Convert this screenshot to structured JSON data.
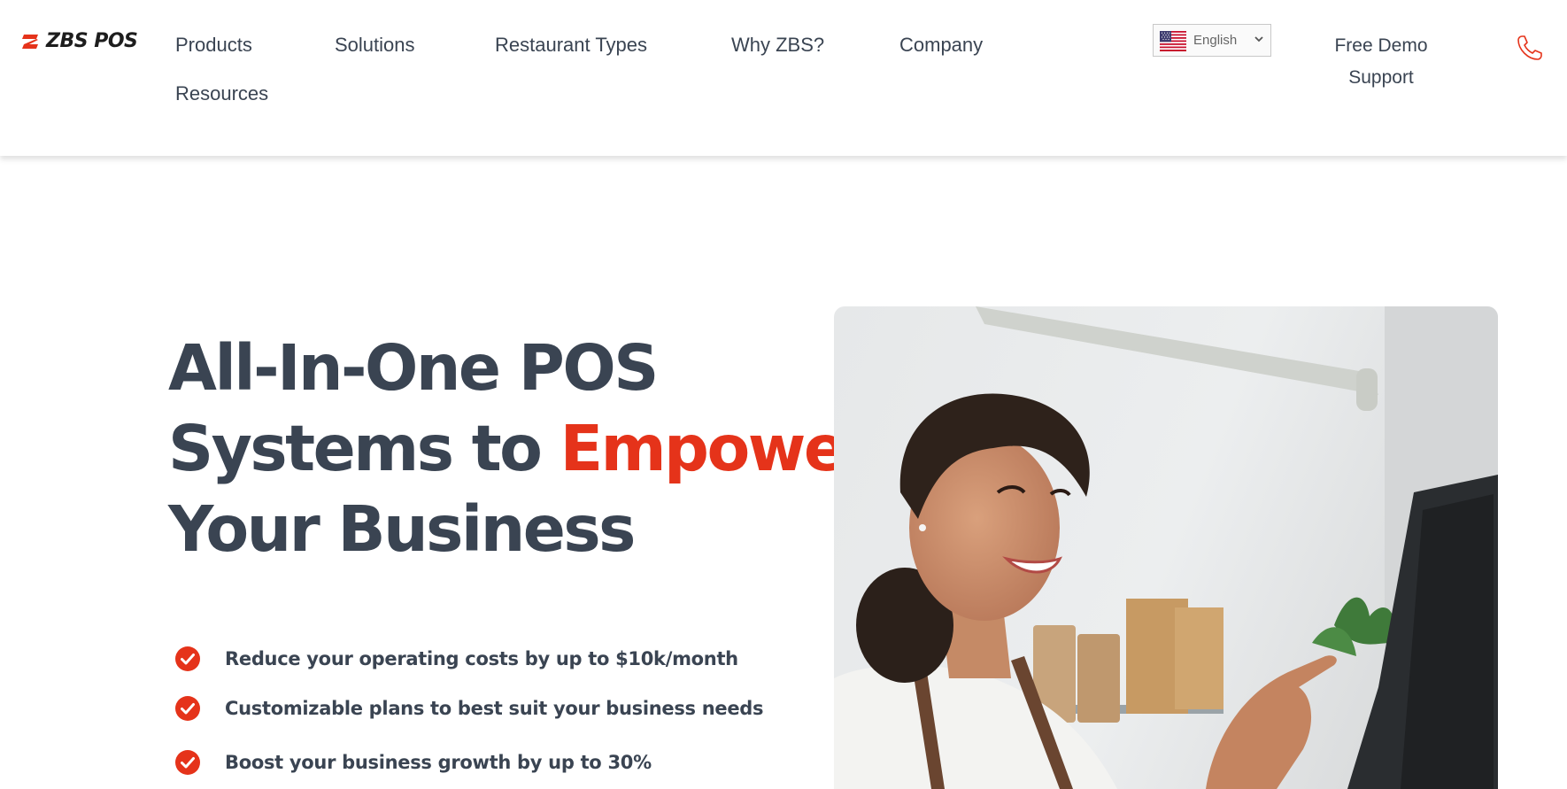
{
  "brand": {
    "name": "ZBS POS",
    "accent_color": "#e5331a",
    "text_color": "#3a4452"
  },
  "nav": {
    "items": [
      "Products",
      "Solutions",
      "Restaurant Types",
      "Why ZBS?",
      "Company",
      "Resources"
    ]
  },
  "language": {
    "selected": "English",
    "flag_icon": "us-flag-icon",
    "caret_icon": "chevron-down-icon"
  },
  "header_links": {
    "free_demo": "Free Demo",
    "support": "Support",
    "phone_icon": "phone-icon"
  },
  "hero": {
    "title_line1": "All-In-One POS",
    "title_line2_prefix": "Systems to ",
    "title_line2_accent": "Empower",
    "title_line3": "Your Business",
    "features": [
      "Reduce your operating costs by up to $10k/month",
      "Customizable plans to best suit your business needs",
      "Boost your business growth by up to 30%"
    ],
    "feature_icon": "check-circle-icon",
    "image": "woman-using-pos-terminal-photo"
  }
}
